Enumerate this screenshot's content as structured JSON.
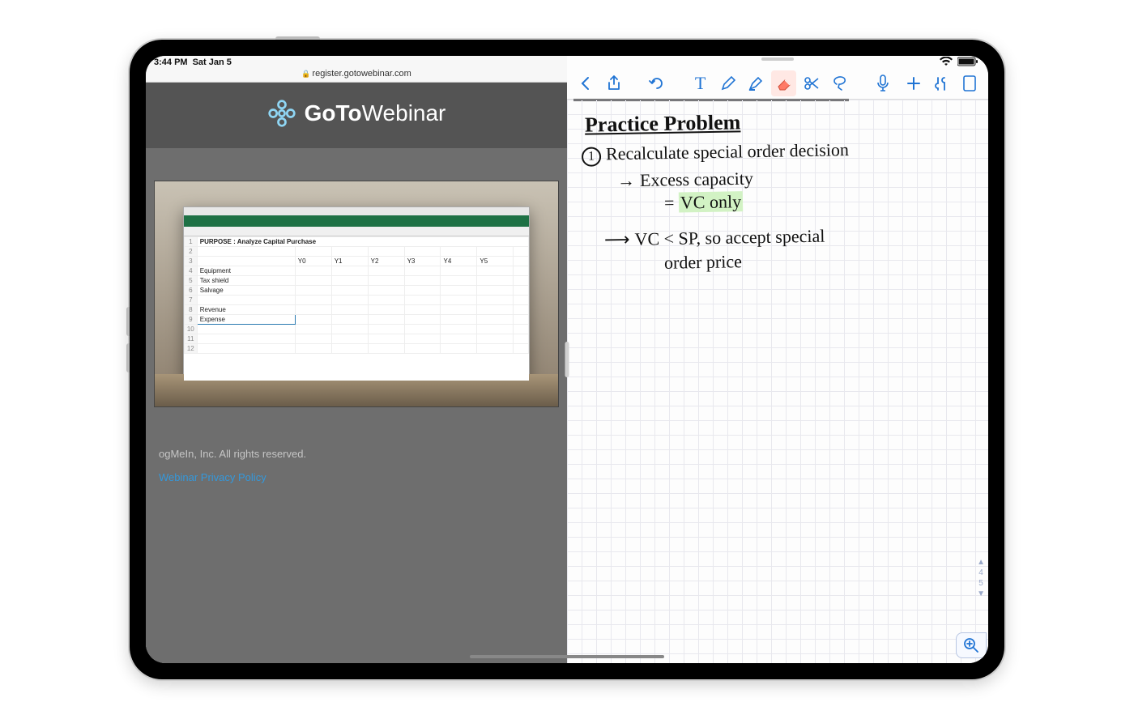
{
  "statusbar": {
    "time": "3:44 PM",
    "date": "Sat Jan 5"
  },
  "safari": {
    "url": "register.gotowebinar.com",
    "brand_prefix": "GoTo",
    "brand_suffix": "Webinar",
    "footer_copyright": "ogMeIn, Inc. All rights reserved.",
    "footer_link": "Webinar Privacy Policy"
  },
  "excel": {
    "purpose_label": "PURPOSE : Analyze Capital Purchase",
    "col_headers": [
      "Y0",
      "Y1",
      "Y2",
      "Y3",
      "Y4",
      "Y5"
    ],
    "row_labels": [
      "Equipment",
      "Tax shield",
      "Salvage",
      "",
      "Revenue",
      "Expense"
    ]
  },
  "notes_toolbar": {
    "icons": [
      "back",
      "share",
      "undo",
      "text",
      "pen",
      "highlighter",
      "eraser",
      "scissors",
      "lasso",
      "mic",
      "add",
      "wrench",
      "page"
    ]
  },
  "handwriting": {
    "title": "Practice Problem",
    "line1_num": "1",
    "line1": "Recalculate special order decision",
    "line2": "Excess capacity",
    "line3_eq": "=",
    "line3_hl": "VC only",
    "line4": "VC < SP, so accept special",
    "line5": "order price"
  },
  "page_nav": {
    "up": "▲",
    "curr": "4",
    "next": "5",
    "down": "▼"
  },
  "colors": {
    "ios_blue": "#2074d4",
    "eraser_bg": "#ff7a66",
    "excel_green": "#1e7145"
  }
}
